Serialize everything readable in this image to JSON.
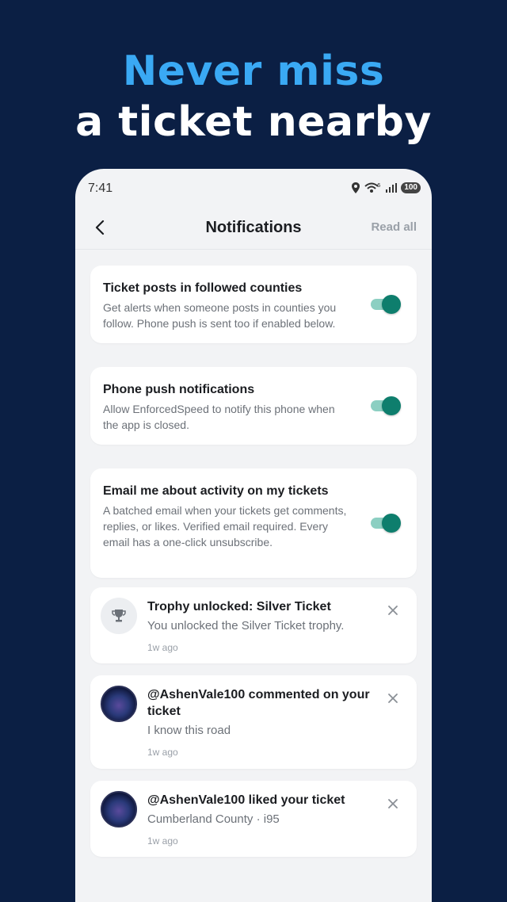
{
  "headline": {
    "line1": "Never miss",
    "line2": "a ticket nearby"
  },
  "status_bar": {
    "time": "7:41",
    "battery": "100",
    "wifi_label": "6"
  },
  "header": {
    "title": "Notifications",
    "read_all": "Read all"
  },
  "settings": [
    {
      "title": "Ticket posts in followed counties",
      "description": "Get alerts when someone posts in counties you follow. Phone push is sent too if enabled below.",
      "enabled": true
    },
    {
      "title": "Phone push notifications",
      "description": "Allow EnforcedSpeed to notify this phone when the app is closed.",
      "enabled": true
    },
    {
      "title": "Email me about activity on my tickets",
      "description": "A batched email when your tickets get comments, replies, or likes. Verified email required. Every email has a one-click unsubscribe.",
      "enabled": true
    }
  ],
  "notifications": [
    {
      "title": "Trophy unlocked: Silver Ticket",
      "body": "You unlocked the Silver Ticket trophy.",
      "time": "1w ago",
      "icon": "trophy-icon"
    },
    {
      "title": "@AshenVale100 commented on your ticket",
      "body": "I know this road",
      "time": "1w ago",
      "icon": "user-avatar"
    },
    {
      "title": "@AshenVale100 liked your ticket",
      "body": "Cumberland County · i95",
      "time": "1w ago",
      "icon": "user-avatar"
    }
  ],
  "colors": {
    "background": "#0b1f44",
    "accent": "#3aa9f4",
    "toggle_on": "#0e7e6d"
  }
}
